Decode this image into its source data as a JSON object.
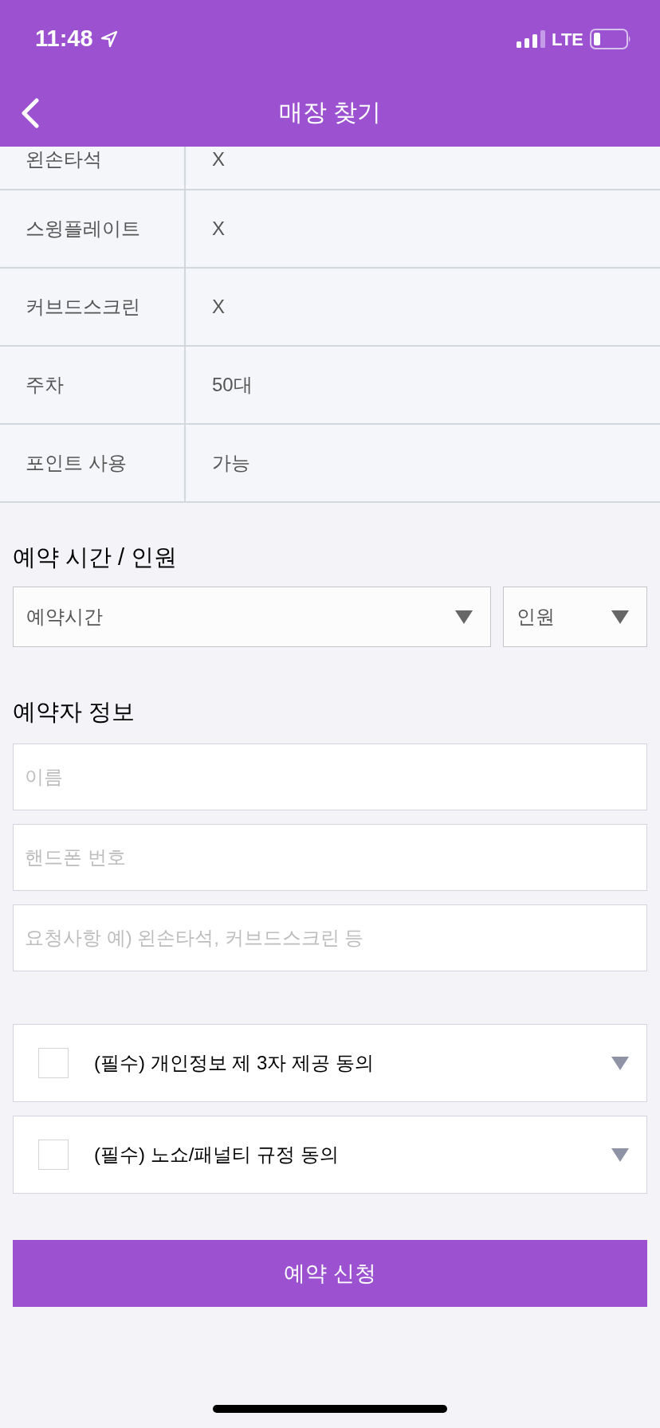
{
  "status_bar": {
    "time": "11:48",
    "network": "LTE"
  },
  "header": {
    "title": "매장 찾기"
  },
  "store_info": {
    "rows": [
      {
        "label": "왼손타석",
        "value": "X"
      },
      {
        "label": "스윙플레이트",
        "value": "X"
      },
      {
        "label": "커브드스크린",
        "value": "X"
      },
      {
        "label": "주차",
        "value": "50대"
      },
      {
        "label": "포인트 사용",
        "value": "가능"
      }
    ]
  },
  "reservation_time": {
    "heading": "예약 시간 / 인원",
    "time_select": {
      "label": "예약시간"
    },
    "people_select": {
      "label": "인원"
    }
  },
  "reserver_info": {
    "heading": "예약자 정보",
    "fields": [
      {
        "placeholder": "이름"
      },
      {
        "placeholder": "핸드폰 번호"
      },
      {
        "placeholder": "요청사항 예) 왼손타석, 커브드스크린 등"
      }
    ]
  },
  "agreements": [
    {
      "label": "(필수) 개인정보 제 3자 제공 동의",
      "checked": false
    },
    {
      "label": "(필수) 노쇼/패널티 규정 동의",
      "checked": false
    }
  ],
  "submit_button": {
    "label": "예약 신청"
  }
}
